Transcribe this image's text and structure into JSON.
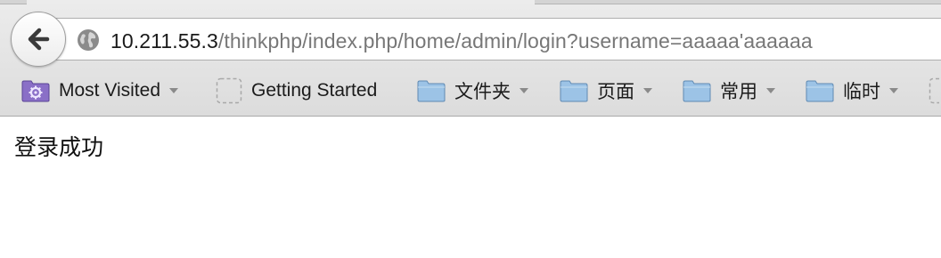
{
  "address_bar": {
    "url_host": "10.211.55.3",
    "url_path": "/thinkphp/index.php/home/admin/login?username=aaaaa'aaaaaa"
  },
  "bookmarks": [
    {
      "label": "Most Visited",
      "icon": "gear-folder-icon",
      "has_menu": true
    },
    {
      "label": "Getting Started",
      "icon": "bookmark-placeholder-icon",
      "has_menu": false
    },
    {
      "label": "文件夹",
      "icon": "folder-icon",
      "has_menu": true
    },
    {
      "label": "页面",
      "icon": "folder-icon",
      "has_menu": true
    },
    {
      "label": "常用",
      "icon": "folder-icon",
      "has_menu": true
    },
    {
      "label": "临时",
      "icon": "folder-icon",
      "has_menu": true
    }
  ],
  "page": {
    "message": "登录成功"
  },
  "colors": {
    "url_host": "#1a1a1a",
    "url_path": "#777777",
    "folder_fill": "#9cc3e6",
    "most_visited_fill": "#8a6fc7"
  }
}
